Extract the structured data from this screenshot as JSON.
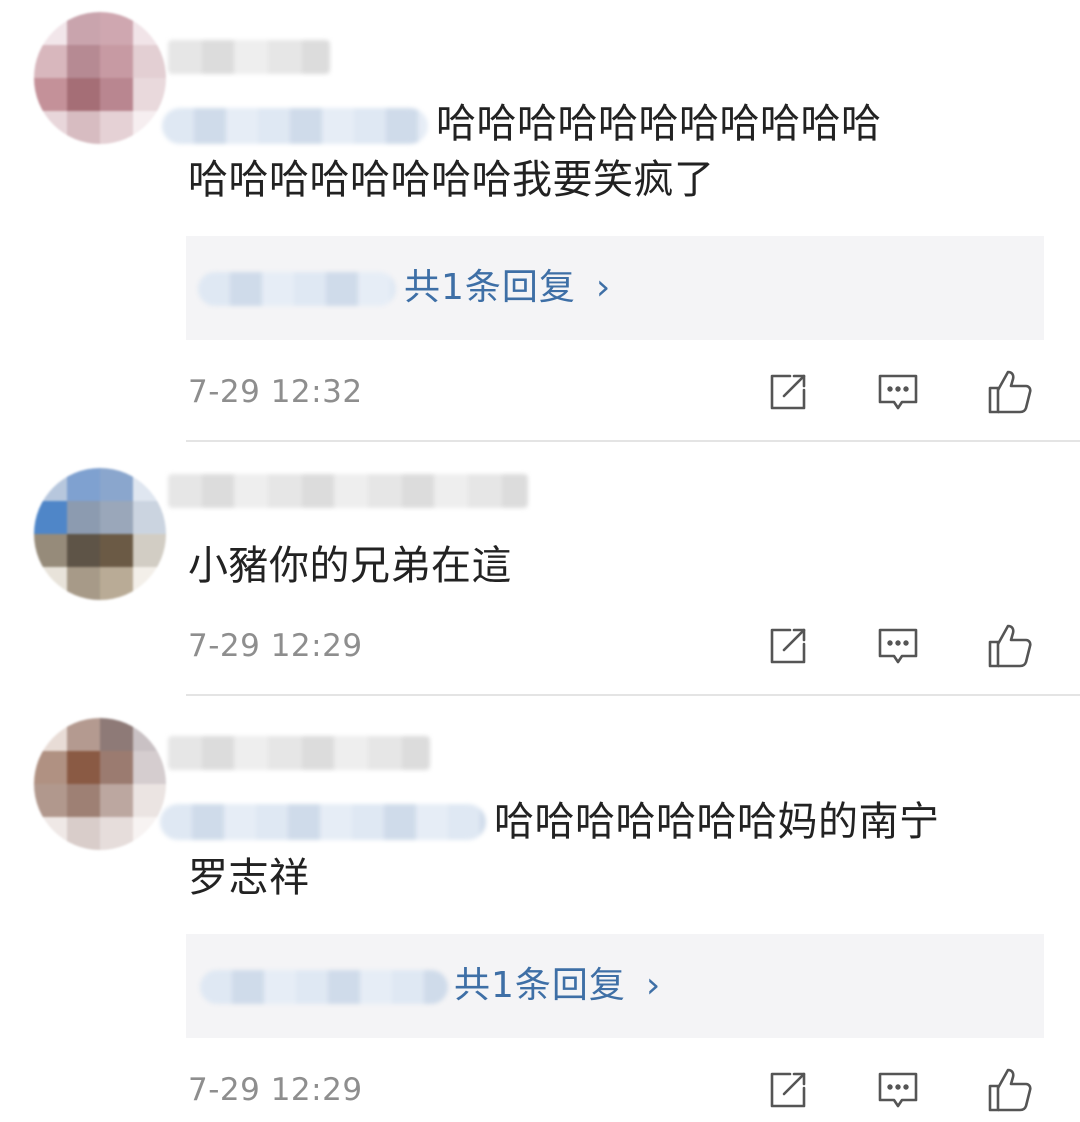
{
  "comments": [
    {
      "text_line1": "哈哈哈哈哈哈哈哈哈哈哈",
      "text_line2": "哈哈哈哈哈哈哈哈我要笑疯了",
      "reply_link": "共1条回复",
      "reply_chevron": "›",
      "timestamp": "7-29 12:32",
      "avatar_colors": [
        "#f2e6ea",
        "#c9a4ad",
        "#cfa7b0",
        "#f1e4e8",
        "#d8b7bd",
        "#b68a93",
        "#c79aa3",
        "#e3cfd3",
        "#c49199",
        "#a56e76",
        "#b98690",
        "#e9d9dc",
        "#e8d6da",
        "#d7bcc1",
        "#e5d1d5",
        "#f6eef0"
      ]
    },
    {
      "text": "小豬你的兄弟在這",
      "timestamp": "7-29 12:29",
      "avatar_colors": [
        "#b7c7dd",
        "#7fa1d0",
        "#8aa6cd",
        "#dfe6f0",
        "#4f86c8",
        "#8c9bb0",
        "#9aa7ba",
        "#cbd4e0",
        "#968b7a",
        "#5e5447",
        "#6b5a45",
        "#d2cdc4",
        "#e8e3da",
        "#a79a88",
        "#b9ab96",
        "#f3efe9"
      ]
    },
    {
      "text_line1": "哈哈哈哈哈哈哈妈的南宁",
      "text_line2": "罗志祥",
      "reply_link": "共1条回复",
      "reply_chevron": "›",
      "timestamp": "7-29 12:29",
      "avatar_colors": [
        "#e8dcd6",
        "#b49a90",
        "#8e7a77",
        "#c9c1c4",
        "#b09182",
        "#8a5a44",
        "#9b7b70",
        "#d5cdcf",
        "#b1988d",
        "#9e8074",
        "#bca7a0",
        "#ebe4e2",
        "#efe8e6",
        "#d9cdca",
        "#e6dddb",
        "#f7f3f2"
      ]
    }
  ],
  "icons": {
    "repost": "repost-icon",
    "comment": "comment-icon",
    "like": "thumbs-up-icon"
  },
  "colors": {
    "link": "#3e6fa6",
    "text": "#222222",
    "timestamp": "#8e8e8e",
    "reply_bg": "#f4f4f6"
  }
}
